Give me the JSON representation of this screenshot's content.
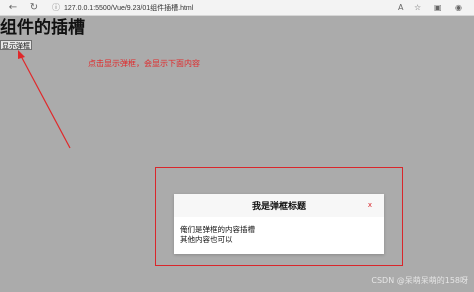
{
  "browser": {
    "url": "127.0.0.1:5500/Vue/9.23/01组件插槽.html",
    "info_icon": "ⓘ"
  },
  "page": {
    "title": "组件的插槽",
    "show_button_label": "显示弹框"
  },
  "annotation": {
    "text": "点击显示弹框，会显示下面内容",
    "color": "#e0282a"
  },
  "modal": {
    "title": "我是弹框标题",
    "close_label": "x",
    "body_line1": "俺们是弹框的内容插槽",
    "body_line2": "其他内容也可以"
  },
  "watermark": "CSDN @呆萌呆萌的158呀",
  "colors": {
    "overlay": "#ababab",
    "highlight": "#d9262b"
  }
}
